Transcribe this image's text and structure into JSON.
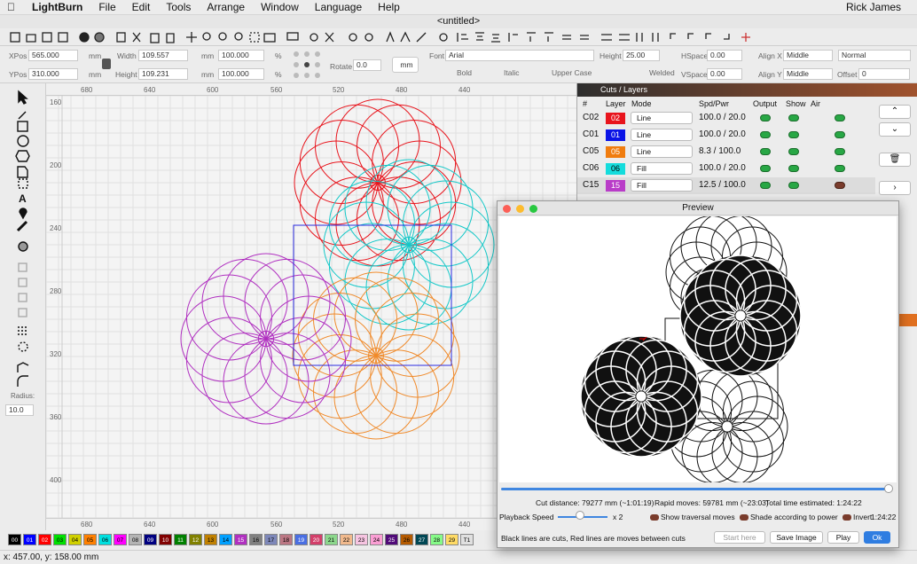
{
  "menubar": {
    "apple": "",
    "app": "LightBurn",
    "items": [
      "File",
      "Edit",
      "Tools",
      "Arrange",
      "Window",
      "Language",
      "Help"
    ],
    "user": "Rick James"
  },
  "window_title": "<untitled>",
  "props": {
    "xpos_label": "XPos",
    "xpos": "565.000",
    "ypos_label": "YPos",
    "ypos": "310.000",
    "unit": "mm",
    "width_label": "Width",
    "width": "109.557",
    "height_label": "Height",
    "height": "109.231",
    "scale_w": "100.000",
    "scale_h": "100.000",
    "pct": "%",
    "rotate_label": "Rotate",
    "rotate": "0.0",
    "mm_button": "mm",
    "font_label": "Font",
    "font": "Arial",
    "fheight_label": "Height",
    "fheight": "25.00",
    "bold": "Bold",
    "italic": "Italic",
    "upper": "Upper Case",
    "welded": "Welded",
    "hspace_label": "HSpace",
    "hspace": "0.00",
    "vspace_label": "VSpace",
    "vspace": "0.00",
    "alignx_label": "Align X",
    "alignx": "Middle",
    "aligny_label": "Align Y",
    "aligny": "Middle",
    "normal": "Normal",
    "offset_label": "Offset",
    "offset": "0"
  },
  "left_tools": {
    "radius_label": "Radius:",
    "radius": "10.0"
  },
  "ruler": {
    "top": [
      "680",
      "640",
      "600",
      "560",
      "520",
      "480",
      "440"
    ],
    "left": [
      "160",
      "200",
      "240",
      "280",
      "320",
      "360",
      "400"
    ]
  },
  "cuts": {
    "title": "Cuts / Layers",
    "headers": [
      "#",
      "Layer",
      "Mode",
      "Spd/Pwr",
      "Output",
      "Show",
      "Air"
    ],
    "rows": [
      {
        "id": "C02",
        "layer": "02",
        "color": "#e8141c",
        "mode": "Line",
        "spd": "100.0 / 20.0",
        "air": true
      },
      {
        "id": "C01",
        "layer": "01",
        "color": "#0a14e6",
        "mode": "Line",
        "spd": "100.0 / 20.0",
        "air": true
      },
      {
        "id": "C05",
        "layer": "05",
        "color": "#f07c0e",
        "mode": "Line",
        "spd": "8.3 / 100.0",
        "air": true
      },
      {
        "id": "C06",
        "layer": "06",
        "color": "#14dcdc",
        "mode": "Fill",
        "spd": "100.0 / 20.0",
        "air": true
      },
      {
        "id": "C15",
        "layer": "15",
        "color": "#b93cc8",
        "mode": "Fill",
        "spd": "12.5 / 100.0",
        "air": false
      }
    ]
  },
  "preview": {
    "title": "Preview",
    "cut_distance": "Cut distance: 79277 mm (~1:01:19)",
    "rapid_moves": "Rapid moves: 59781 mm (~23:03)",
    "total_time": "Total time estimated: 1:24:22",
    "playback_label": "Playback Speed",
    "speed": "x 2",
    "show_traversal": "Show traversal moves",
    "shade": "Shade according to power",
    "invert": "Invert",
    "time": "1:24:22",
    "legend": "Black lines are cuts, Red lines are moves between cuts",
    "start_here": "Start here",
    "save_image": "Save Image",
    "play": "Play",
    "ok": "Ok"
  },
  "palette": [
    {
      "l": "00",
      "c": "#000000"
    },
    {
      "l": "01",
      "c": "#0000ff"
    },
    {
      "l": "02",
      "c": "#ff0000"
    },
    {
      "l": "03",
      "c": "#00e000"
    },
    {
      "l": "04",
      "c": "#d0d000"
    },
    {
      "l": "05",
      "c": "#ff8000"
    },
    {
      "l": "06",
      "c": "#00e0e0"
    },
    {
      "l": "07",
      "c": "#ff00ff"
    },
    {
      "l": "08",
      "c": "#b4b4b4"
    },
    {
      "l": "09",
      "c": "#000080"
    },
    {
      "l": "10",
      "c": "#800000"
    },
    {
      "l": "11",
      "c": "#008000"
    },
    {
      "l": "12",
      "c": "#808000"
    },
    {
      "l": "13",
      "c": "#c08000"
    },
    {
      "l": "14",
      "c": "#00a0ff"
    },
    {
      "l": "15",
      "c": "#b030c0"
    },
    {
      "l": "16",
      "c": "#808080"
    },
    {
      "l": "17",
      "c": "#7d87b9"
    },
    {
      "l": "18",
      "c": "#bb7784"
    },
    {
      "l": "19",
      "c": "#4a6fe3"
    },
    {
      "l": "20",
      "c": "#d33f6a"
    },
    {
      "l": "21",
      "c": "#8cd78c"
    },
    {
      "l": "22",
      "c": "#f0b98d"
    },
    {
      "l": "23",
      "c": "#f6c4e1"
    },
    {
      "l": "24",
      "c": "#fa9ed4"
    },
    {
      "l": "25",
      "c": "#500a78"
    },
    {
      "l": "26",
      "c": "#b45a00"
    },
    {
      "l": "27",
      "c": "#004754"
    },
    {
      "l": "28",
      "c": "#86fa88"
    },
    {
      "l": "29",
      "c": "#ffdb66"
    },
    {
      "l": "T1",
      "c": "#e0e0e0"
    }
  ],
  "status": "x: 457.00, y: 158.00 mm"
}
